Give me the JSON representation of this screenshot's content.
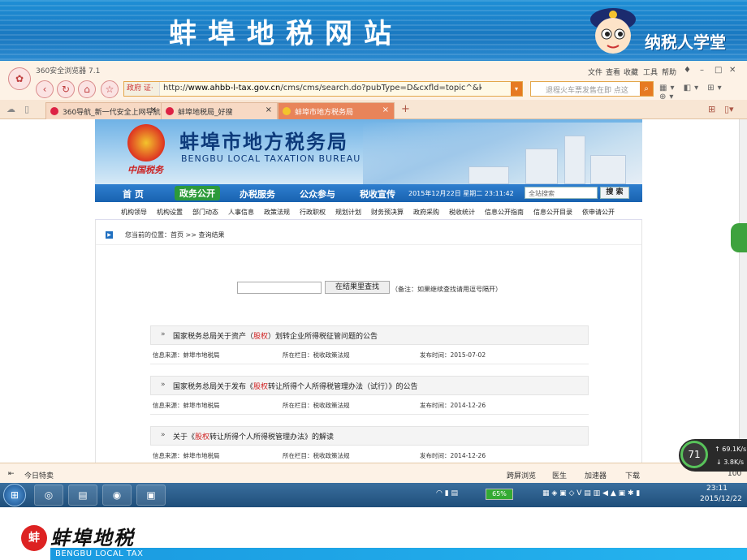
{
  "slide": {
    "title": "蚌埠地税网站",
    "mascot_caption": "纳税人学堂",
    "footer_name": "蚌埠地税",
    "footer_en": "BENGBU LOCAL TAX",
    "footer_logo_char": "蚌"
  },
  "browser": {
    "app_name": "360安全浏览器 7.1",
    "menu": [
      "文件",
      "查看",
      "收藏",
      "工具",
      "帮助"
    ],
    "address_tag": "政府 证·",
    "url_scheme": "http://",
    "url_host": "www.ahbb-l-tax.gov.cn",
    "url_path": "/cms/cms/search.do?pubType=D&cxfld=topic^&ke",
    "search_placeholder": "退程火车票发售在即 点这",
    "tabs": [
      {
        "label": "360导航_新一代安全上网导航",
        "active": false
      },
      {
        "label": "蚌埠地税局_好搜",
        "active": false
      },
      {
        "label": "蚌埠市地方税务局",
        "active": true
      }
    ]
  },
  "site": {
    "name_cn": "蚌埠市地方税务局",
    "name_en": "BENGBU LOCAL TAXATION BUREAU",
    "seal_text": "中国税务",
    "main_nav": [
      "首 页",
      "政务公开",
      "办税服务",
      "公众参与",
      "税收宣传"
    ],
    "active_nav": "政务公开",
    "date": "2015年12月22日 星期二 23:11:42",
    "site_search_placeholder": "全站搜索",
    "site_search_button": "搜 索",
    "sub_nav": [
      "机构领导",
      "机构设置",
      "部门动态",
      "人事信息",
      "政策法规",
      "行政职权",
      "规划计划",
      "财务预决算",
      "政府采购",
      "税收统计",
      "信息公开指南",
      "信息公开目录",
      "依申请公开"
    ],
    "breadcrumb": "您当前的位置：首页 >> 查询结果",
    "in_result_button": "在结果里查找",
    "in_result_note": "（备注：如果继续查找请用逗号隔开）"
  },
  "results": [
    {
      "pre": "国家税务总局关于资产（",
      "hl": "股权",
      "post": "）划转企业所得税征管问题的公告",
      "source": "信息来源：蚌埠市地税局",
      "column": "所在栏目：税收政策法规",
      "date": "发布时间：2015-07-02"
    },
    {
      "pre": "国家税务总局关于发布《",
      "hl": "股权",
      "post": "转让所得个人所得税管理办法（试行）》的公告",
      "source": "信息来源：蚌埠市地税局",
      "column": "所在栏目：税收政策法规",
      "date": "发布时间：2014-12-26"
    },
    {
      "pre": "关于《",
      "hl": "股权",
      "post": "转让所得个人所得税管理办法》的解读",
      "source": "信息来源：蚌埠市地税局",
      "column": "所在栏目：税收政策法规",
      "date": "发布时间：2014-12-26"
    }
  ],
  "statusbar": {
    "left": "今日特卖",
    "items": [
      "跨屏浏览",
      "医生",
      "加速器",
      "下载"
    ],
    "zoom": "100"
  },
  "widget": {
    "percent": "71",
    "up": "69.1K/s",
    "down": "3.8K/s"
  },
  "taskbar": {
    "battery": "65%",
    "time": "23:11",
    "date": "2015/12/22"
  }
}
